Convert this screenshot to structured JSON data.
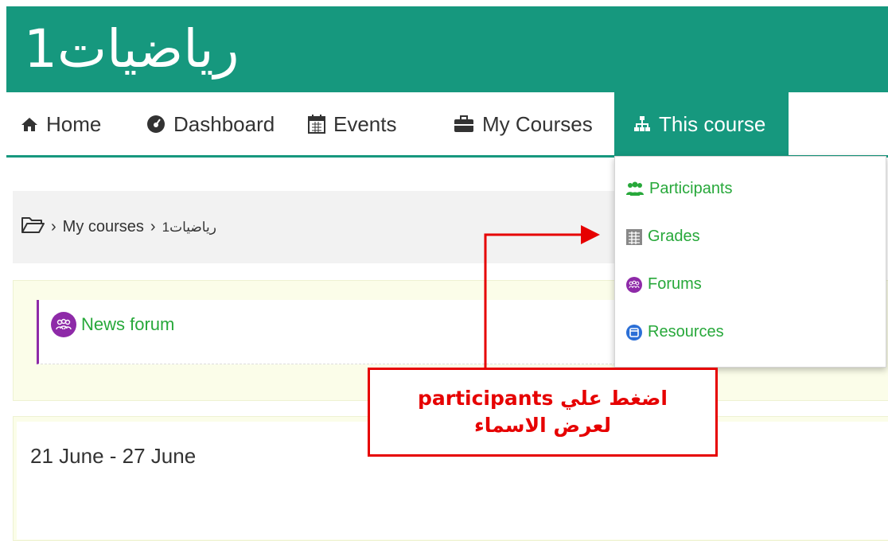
{
  "site": {
    "title": "رياضيات1"
  },
  "nav": {
    "home": "Home",
    "dashboard": "Dashboard",
    "events": "Events",
    "my_courses": "My Courses",
    "this_course": "This course"
  },
  "breadcrumb": {
    "my_courses": "My courses",
    "course": "رياضيات1",
    "separator": "›"
  },
  "news": {
    "label": "News forum"
  },
  "week": {
    "title": "21 June - 27 June"
  },
  "dropdown": {
    "items": [
      {
        "label": "Participants",
        "icon": "users-icon"
      },
      {
        "label": "Grades",
        "icon": "table-icon"
      },
      {
        "label": "Forums",
        "icon": "forum-icon"
      },
      {
        "label": "Resources",
        "icon": "resource-icon"
      }
    ]
  },
  "callout": {
    "line1": "participants اضغط علي",
    "line2": "لعرض الاسماء"
  },
  "colors": {
    "brand": "#16987e",
    "link": "#27a83a",
    "forum": "#8e2aa8",
    "annotation": "#e60000"
  }
}
